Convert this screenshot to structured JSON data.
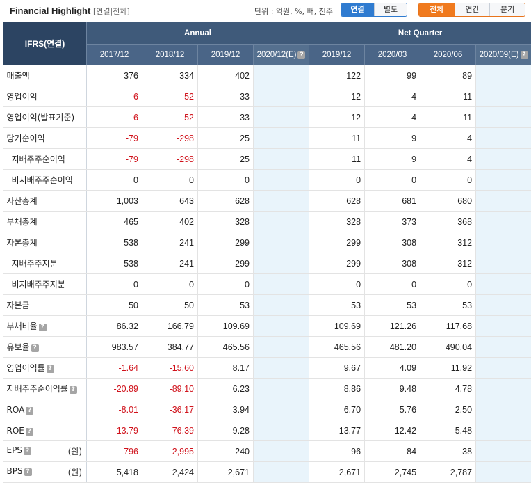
{
  "header": {
    "title": "Financial Highlight",
    "subtitle": "[연결|전체]",
    "unit_text": "단위 : 억원, %, 배, 천주",
    "consolidation_options": [
      "연결",
      "별도"
    ],
    "consolidation_selected": "연결",
    "period_options": [
      "전체",
      "연간",
      "분기"
    ],
    "period_selected": "전체"
  },
  "table": {
    "corner_label": "IFRS(연결)",
    "annual_label": "Annual",
    "quarter_label": "Net Quarter",
    "annual_periods": [
      "2017/12",
      "2018/12",
      "2019/12",
      "2020/12(E)"
    ],
    "quarter_periods": [
      "2019/12",
      "2020/03",
      "2020/06",
      "2020/09(E)"
    ],
    "help_icon_glyph": "?",
    "rows": [
      {
        "label": "매출액",
        "sub": false,
        "help": false,
        "unit": "",
        "values": [
          "376",
          "334",
          "402",
          "",
          "122",
          "99",
          "89",
          ""
        ]
      },
      {
        "label": "영업이익",
        "sub": false,
        "help": false,
        "unit": "",
        "values": [
          "-6",
          "-52",
          "33",
          "",
          "12",
          "4",
          "11",
          ""
        ]
      },
      {
        "label": "영업이익(발표기준)",
        "sub": false,
        "help": false,
        "unit": "",
        "values": [
          "-6",
          "-52",
          "33",
          "",
          "12",
          "4",
          "11",
          ""
        ]
      },
      {
        "label": "당기순이익",
        "sub": false,
        "help": false,
        "unit": "",
        "values": [
          "-79",
          "-298",
          "25",
          "",
          "11",
          "9",
          "4",
          ""
        ]
      },
      {
        "label": "지배주주순이익",
        "sub": true,
        "help": false,
        "unit": "",
        "values": [
          "-79",
          "-298",
          "25",
          "",
          "11",
          "9",
          "4",
          ""
        ]
      },
      {
        "label": "비지배주주순이익",
        "sub": true,
        "help": false,
        "unit": "",
        "values": [
          "0",
          "0",
          "0",
          "",
          "0",
          "0",
          "0",
          ""
        ]
      },
      {
        "label": "자산총계",
        "sub": false,
        "help": false,
        "unit": "",
        "values": [
          "1,003",
          "643",
          "628",
          "",
          "628",
          "681",
          "680",
          ""
        ]
      },
      {
        "label": "부채총계",
        "sub": false,
        "help": false,
        "unit": "",
        "values": [
          "465",
          "402",
          "328",
          "",
          "328",
          "373",
          "368",
          ""
        ]
      },
      {
        "label": "자본총계",
        "sub": false,
        "help": false,
        "unit": "",
        "values": [
          "538",
          "241",
          "299",
          "",
          "299",
          "308",
          "312",
          ""
        ]
      },
      {
        "label": "지배주주지분",
        "sub": true,
        "help": false,
        "unit": "",
        "values": [
          "538",
          "241",
          "299",
          "",
          "299",
          "308",
          "312",
          ""
        ]
      },
      {
        "label": "비지배주주지분",
        "sub": true,
        "help": false,
        "unit": "",
        "values": [
          "0",
          "0",
          "0",
          "",
          "0",
          "0",
          "0",
          ""
        ]
      },
      {
        "label": "자본금",
        "sub": false,
        "help": false,
        "unit": "",
        "values": [
          "50",
          "50",
          "53",
          "",
          "53",
          "53",
          "53",
          ""
        ]
      },
      {
        "label": "부채비율",
        "sub": false,
        "help": true,
        "unit": "",
        "values": [
          "86.32",
          "166.79",
          "109.69",
          "",
          "109.69",
          "121.26",
          "117.68",
          ""
        ]
      },
      {
        "label": "유보율",
        "sub": false,
        "help": true,
        "unit": "",
        "values": [
          "983.57",
          "384.77",
          "465.56",
          "",
          "465.56",
          "481.20",
          "490.04",
          ""
        ]
      },
      {
        "label": "영업이익률",
        "sub": false,
        "help": true,
        "unit": "",
        "values": [
          "-1.64",
          "-15.60",
          "8.17",
          "",
          "9.67",
          "4.09",
          "11.92",
          ""
        ]
      },
      {
        "label": "지배주주순이익률",
        "sub": false,
        "help": true,
        "unit": "",
        "values": [
          "-20.89",
          "-89.10",
          "6.23",
          "",
          "8.86",
          "9.48",
          "4.78",
          ""
        ]
      },
      {
        "label": "ROA",
        "sub": false,
        "help": true,
        "unit": "",
        "values": [
          "-8.01",
          "-36.17",
          "3.94",
          "",
          "6.70",
          "5.76",
          "2.50",
          ""
        ]
      },
      {
        "label": "ROE",
        "sub": false,
        "help": true,
        "unit": "",
        "values": [
          "-13.79",
          "-76.39",
          "9.28",
          "",
          "13.77",
          "12.42",
          "5.48",
          ""
        ]
      },
      {
        "label": "EPS",
        "sub": false,
        "help": true,
        "unit": "(원)",
        "values": [
          "-796",
          "-2,995",
          "240",
          "",
          "96",
          "84",
          "38",
          ""
        ]
      },
      {
        "label": "BPS",
        "sub": false,
        "help": true,
        "unit": "(원)",
        "values": [
          "5,418",
          "2,424",
          "2,671",
          "",
          "2,671",
          "2,745",
          "2,787",
          ""
        ]
      }
    ]
  },
  "colors": {
    "header_bg": "#3f5a7a",
    "estimate_bg": "#e9f4fb",
    "negative_text": "#d0121b",
    "consolidation_active": "#2f7bd0",
    "period_active": "#f07a1e"
  },
  "icons": {
    "help": "help-icon"
  }
}
